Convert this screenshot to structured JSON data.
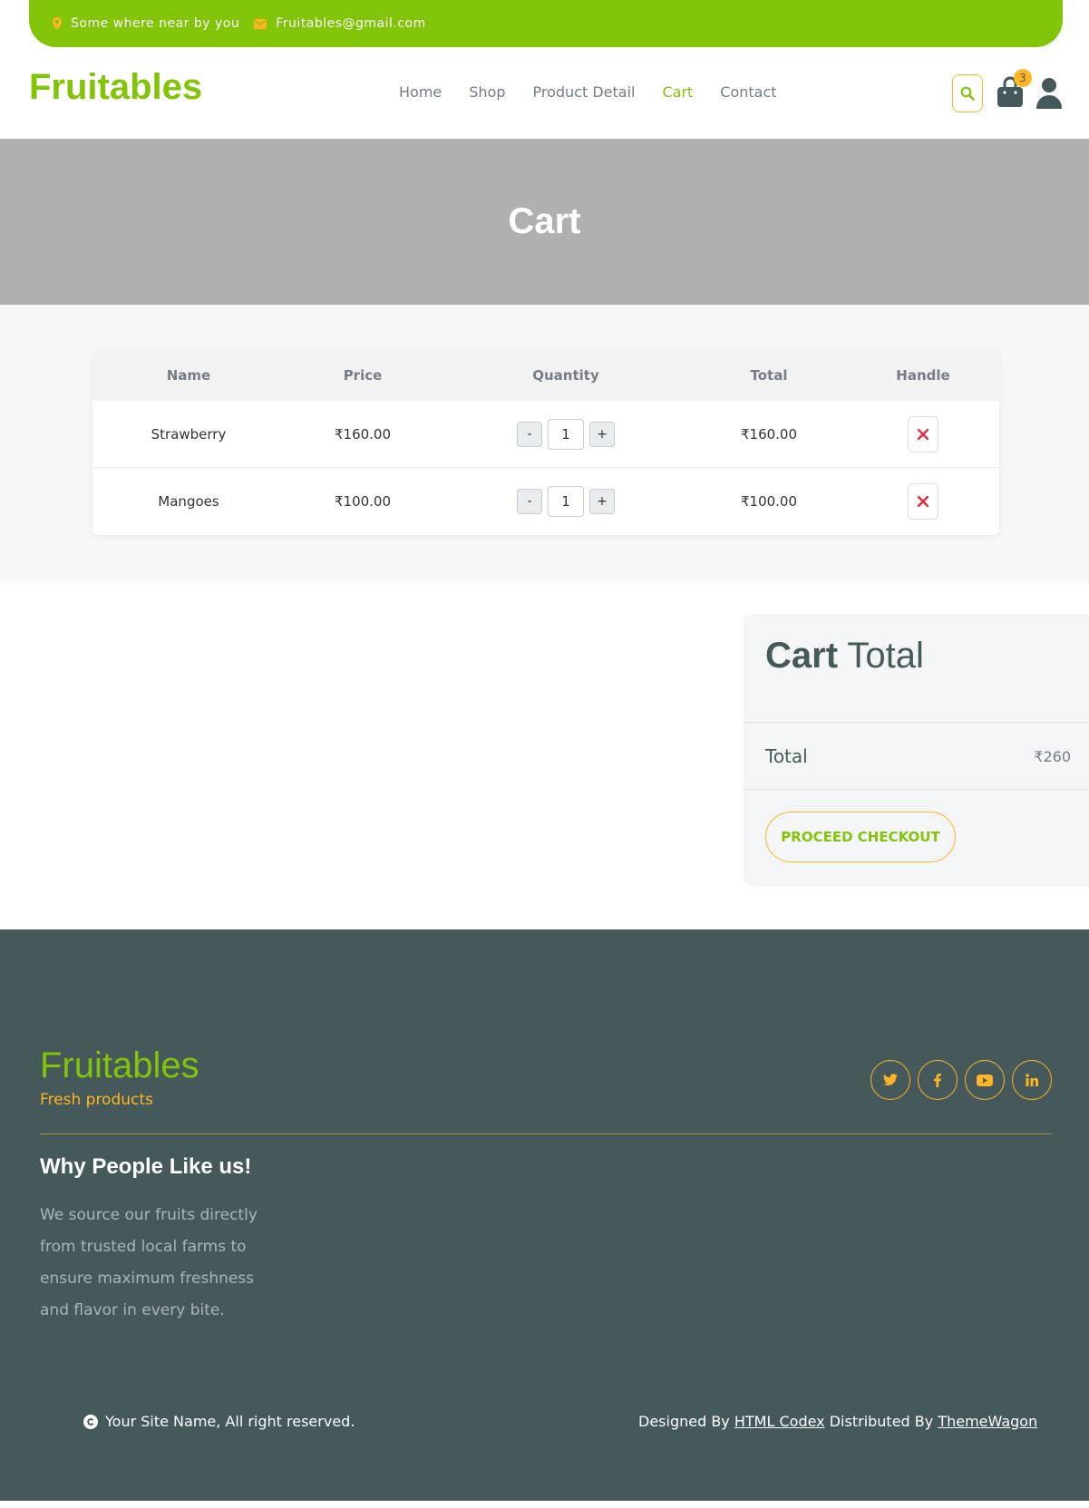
{
  "topbar": {
    "location": "Some where near by you",
    "email": "Fruitables@gmail.com"
  },
  "header": {
    "brand": "Fruitables",
    "nav": [
      "Home",
      "Shop",
      "Product Detail",
      "Cart",
      "Contact"
    ],
    "active_nav": "Cart",
    "cart_count": "3"
  },
  "hero": {
    "title": "Cart"
  },
  "cart_table": {
    "headers": [
      "Name",
      "Price",
      "Quantity",
      "Total",
      "Handle"
    ],
    "rows": [
      {
        "name": "Strawberry",
        "price": "₹160.00",
        "quantity": "1",
        "total": "₹160.00"
      },
      {
        "name": "Mangoes",
        "price": "₹100.00",
        "quantity": "1",
        "total": "₹100.00"
      }
    ],
    "minus_label": "-",
    "plus_label": "+"
  },
  "cart_total": {
    "title_bold": "Cart",
    "title_rest": "Total",
    "total_label": "Total",
    "total_amount": "₹260",
    "checkout_label": "PROCEED CHECKOUT"
  },
  "footer": {
    "brand": "Fruitables",
    "tagline": "Fresh products",
    "heading": "Why People Like us!",
    "text": "We source our fruits directly from trusted local farms to ensure maximum freshness and flavor in every bite.",
    "copyright": "Your Site Name, All right reserved.",
    "designed_prefix": "Designed By",
    "designer": "HTML Codex",
    "distributed_prefix": "Distributed By",
    "distributor": "ThemeWagon"
  },
  "colors": {
    "primary": "#81c408",
    "secondary": "#ffb524",
    "dark": "#45595b",
    "danger": "#dc3545"
  }
}
